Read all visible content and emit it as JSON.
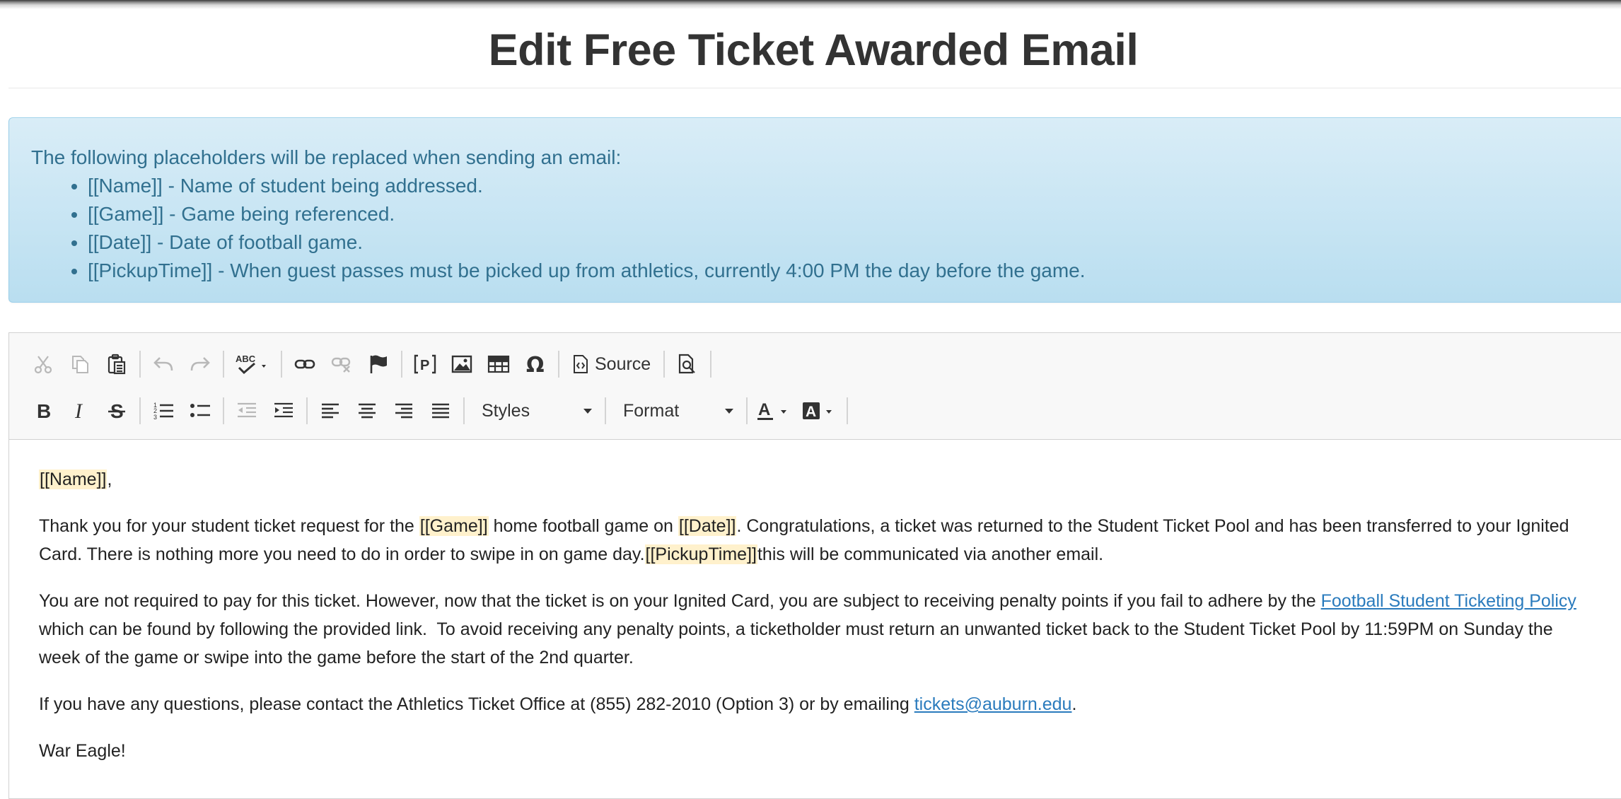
{
  "page": {
    "title": "Edit Free Ticket Awarded Email"
  },
  "info": {
    "intro": "The following placeholders will be replaced when sending an email:",
    "items": [
      "[[Name]] - Name of student being addressed.",
      "[[Game]] - Game being referenced.",
      "[[Date]] - Date of football game.",
      "[[PickupTime]] - When guest passes must be picked up from athletics, currently 4:00 PM the day before the game."
    ]
  },
  "toolbar": {
    "source_label": "Source",
    "styles_label": "Styles",
    "format_label": "Format"
  },
  "email": {
    "greeting_placeholder": "[[Name]]",
    "greeting_suffix": ",",
    "p1_a": "Thank you for your student ticket request for the ",
    "p1_ph_game": "[[Game]]",
    "p1_b": " home football game on ",
    "p1_ph_date": "[[Date]]",
    "p1_c": ". Congratulations, a ticket was returned to the Student Ticket Pool and has been transferred to your Ignited Card. There is nothing more you need to do in order to swipe in on game day.",
    "p1_ph_pickup": "[[PickupTime]]",
    "p1_d": "this will be communicated via another email.",
    "p2_a": "You are not required to pay for this ticket. However, now that the ticket is on your Ignited Card, you are subject to receiving penalty points if you fail to adhere by the ",
    "p2_link": "Football Student Ticketing Policy",
    "p2_b": " which can be found by following the provided link.  To avoid receiving any penalty points, a ticketholder must return an unwanted ticket back to the Student Ticket Pool by 11:59PM on Sunday the week of the game or swipe into the game before the start of the 2nd quarter.",
    "p3_a": "If you have any questions, please contact the Athletics Ticket Office at (855) 282-2010 (Option 3) or by emailing ",
    "p3_link": "tickets@auburn.edu",
    "p3_b": ".",
    "signoff": "War Eagle!"
  },
  "colors": {
    "alert_bg": "#d9edf7",
    "alert_text": "#31708f",
    "link": "#2a7bbd",
    "placeholder_highlight": "#fff1cc"
  }
}
